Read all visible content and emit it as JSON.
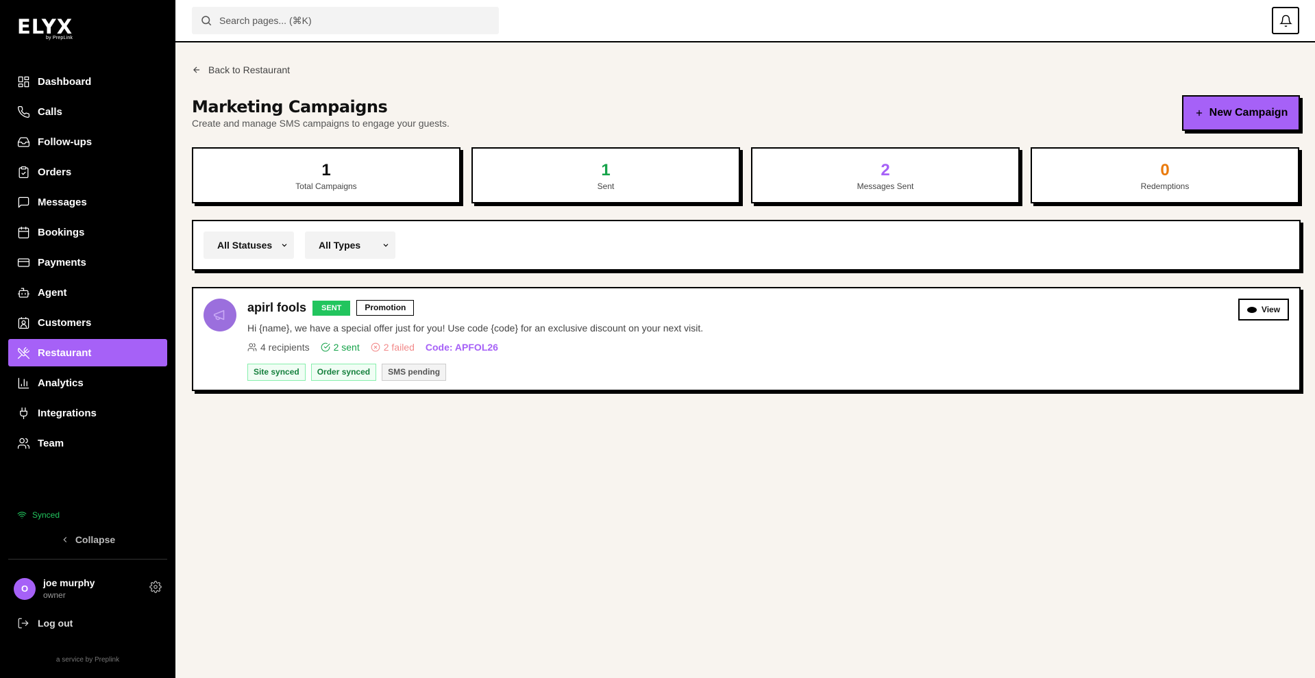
{
  "brand": {
    "logo": "ELYX",
    "logo_sub": "by PrepLink",
    "footer": "a service by Preplink"
  },
  "search": {
    "placeholder": "Search pages... (⌘K)"
  },
  "sidebar": {
    "items": [
      {
        "label": "Dashboard",
        "icon": "dashboard-icon"
      },
      {
        "label": "Calls",
        "icon": "phone-icon"
      },
      {
        "label": "Follow-ups",
        "icon": "inbox-icon"
      },
      {
        "label": "Orders",
        "icon": "clipboard-icon"
      },
      {
        "label": "Messages",
        "icon": "message-icon"
      },
      {
        "label": "Bookings",
        "icon": "calendar-icon"
      },
      {
        "label": "Payments",
        "icon": "credit-card-icon"
      },
      {
        "label": "Agent",
        "icon": "robot-icon"
      },
      {
        "label": "Customers",
        "icon": "contact-icon"
      },
      {
        "label": "Restaurant",
        "icon": "utensils-icon",
        "active": true
      },
      {
        "label": "Analytics",
        "icon": "bar-chart-icon"
      },
      {
        "label": "Integrations",
        "icon": "plug-icon"
      },
      {
        "label": "Team",
        "icon": "users-icon"
      }
    ],
    "status": "Synced",
    "collapse": "Collapse",
    "user": {
      "initial": "O",
      "name": "joe murphy",
      "role": "owner"
    },
    "logout": "Log out"
  },
  "main": {
    "back": "Back to Restaurant",
    "title": "Marketing Campaigns",
    "subtitle": "Create and manage SMS campaigns to engage your guests.",
    "new_button": "New Campaign",
    "stats": [
      {
        "value": "1",
        "label": "Total Campaigns",
        "color": "#111111"
      },
      {
        "value": "1",
        "label": "Sent",
        "color": "#16a34a"
      },
      {
        "value": "2",
        "label": "Messages Sent",
        "color": "#a661f7"
      },
      {
        "value": "0",
        "label": "Redemptions",
        "color": "#ea7a0c"
      }
    ],
    "filters": {
      "status": "All Statuses",
      "type": "All Types"
    },
    "campaigns": [
      {
        "name": "apirl fools",
        "status": "SENT",
        "type": "Promotion",
        "message": "Hi {name}, we have a special offer just for you! Use code {code} for an exclusive discount on your next visit.",
        "recipients": "4 recipients",
        "sent": "2 sent",
        "failed": "2 failed",
        "code": "Code: APFOL26",
        "tags": [
          "Site synced",
          "Order synced",
          "SMS pending"
        ],
        "view": "View"
      }
    ]
  },
  "colors": {
    "accent": "#a661f7",
    "success": "#22c55e",
    "background": "#f8f4ef"
  }
}
